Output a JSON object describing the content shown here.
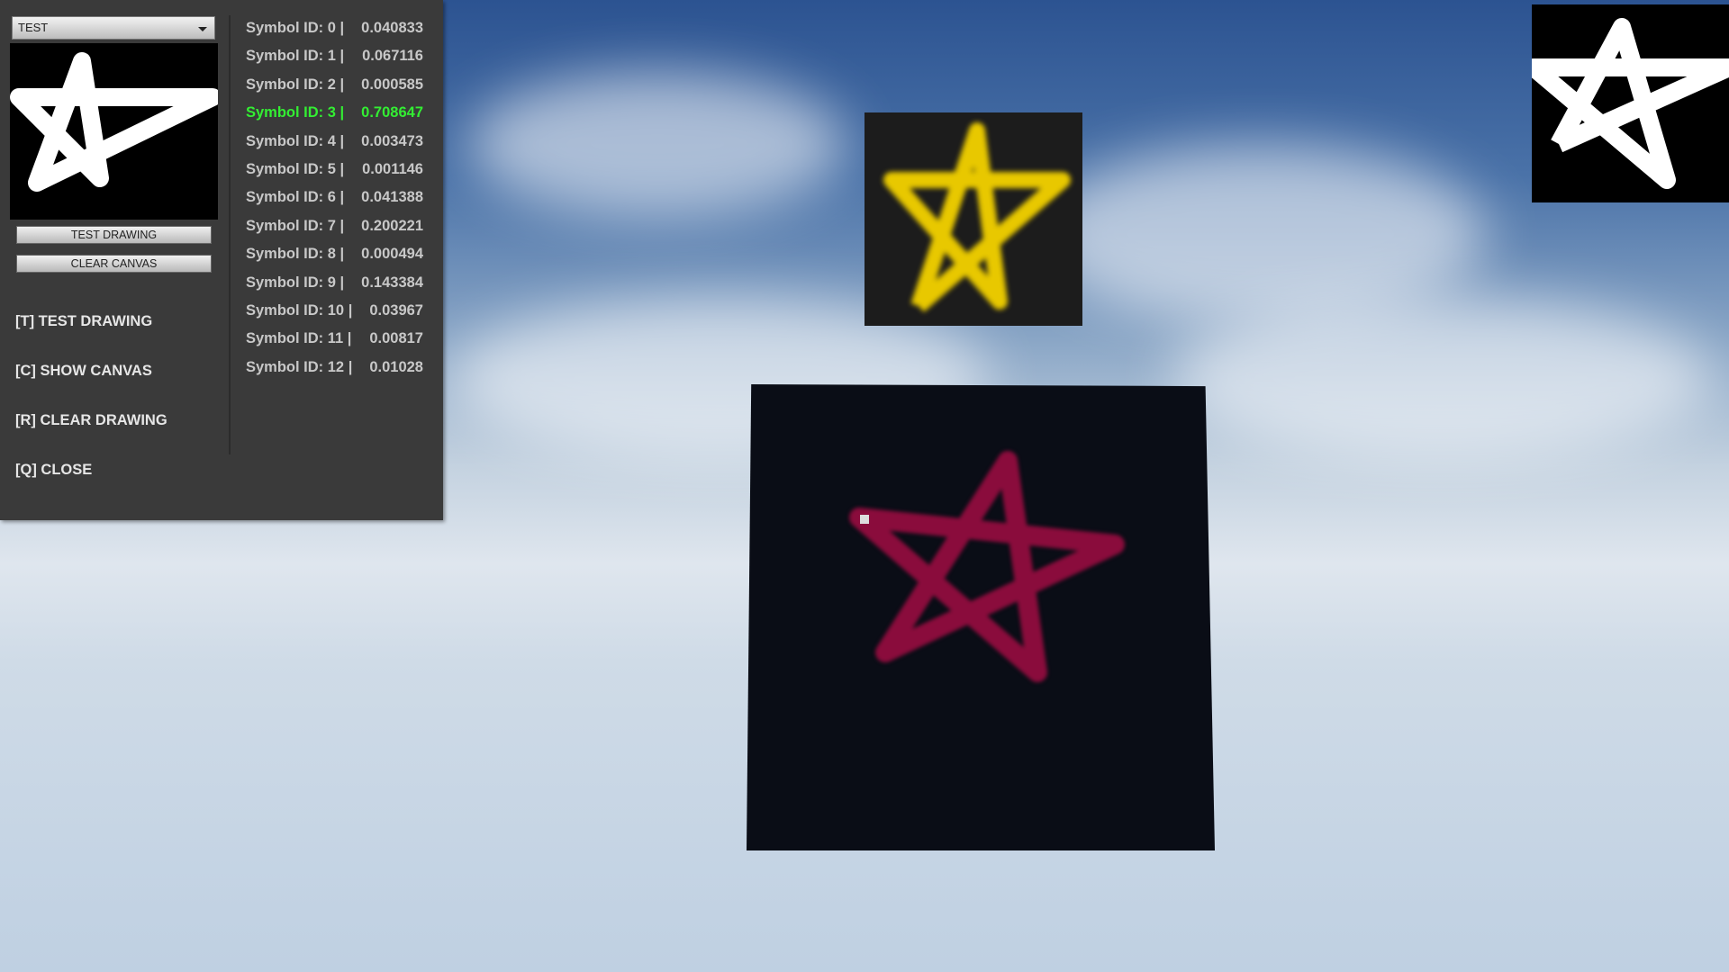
{
  "dropdown": {
    "selected": "TEST"
  },
  "buttons": {
    "test_drawing": "TEST DRAWING",
    "clear_canvas": "CLEAR CANVAS"
  },
  "keys": [
    "[T] TEST DRAWING",
    "[C] SHOW CANVAS",
    "[R] CLEAR DRAWING",
    "[Q] CLOSE"
  ],
  "symbols": [
    {
      "label": "Symbol ID: 0 |",
      "value": "0.040833"
    },
    {
      "label": "Symbol ID: 1 |",
      "value": "0.067116"
    },
    {
      "label": "Symbol ID: 2 |",
      "value": "0.000585"
    },
    {
      "label": "Symbol ID: 3 |",
      "value": "0.708647"
    },
    {
      "label": "Symbol ID: 4 |",
      "value": "0.003473"
    },
    {
      "label": "Symbol ID: 5 |",
      "value": "0.001146"
    },
    {
      "label": "Symbol ID: 6 |",
      "value": "0.041388"
    },
    {
      "label": "Symbol ID: 7 |",
      "value": "0.200221"
    },
    {
      "label": "Symbol ID: 8 |",
      "value": "0.000494"
    },
    {
      "label": "Symbol ID: 9 |",
      "value": "0.143384"
    },
    {
      "label": "Symbol ID: 10 |",
      "value": "0.03967"
    },
    {
      "label": "Symbol ID: 11 |",
      "value": "0.00817"
    },
    {
      "label": "Symbol ID: 12 |",
      "value": "0.01028"
    }
  ],
  "highlighted_index": 3,
  "colors": {
    "highlight": "#33ee33",
    "yellow_star": "#e8c800",
    "drawn_star": "#8a0c3c"
  }
}
